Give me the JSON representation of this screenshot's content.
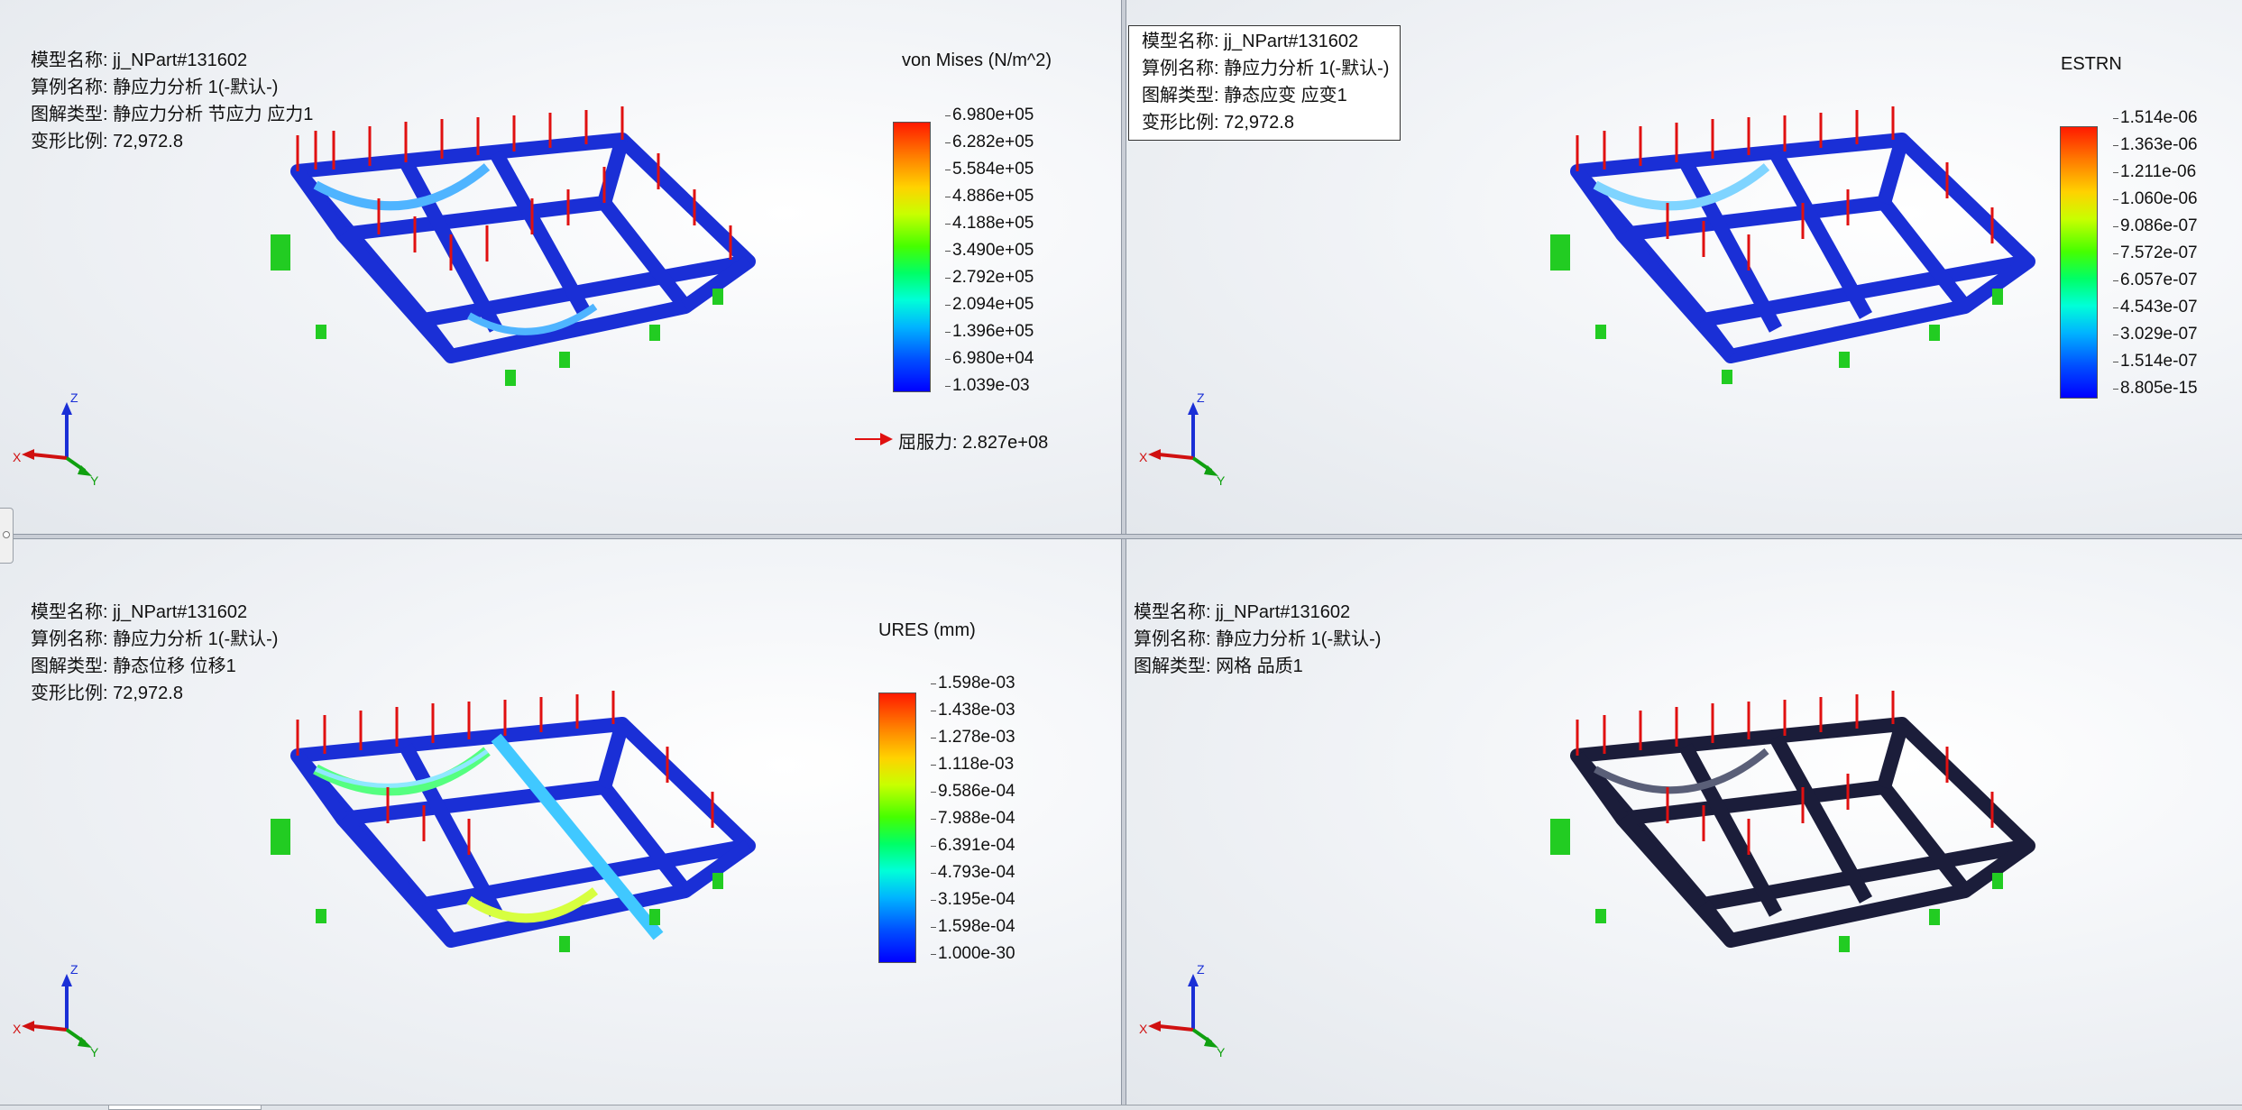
{
  "viewports": {
    "top_left": {
      "info": {
        "line1": "模型名称: jj_NPart#131602",
        "line2": "算例名称: 静应力分析 1(-默认-)",
        "line3": "图解类型: 静应力分析 节应力 应力1",
        "line4": "变形比例: 72,972.8"
      },
      "legend": {
        "title": "von Mises (N/m^2)",
        "ticks": [
          "6.980e+05",
          "6.282e+05",
          "5.584e+05",
          "4.886e+05",
          "4.188e+05",
          "3.490e+05",
          "2.792e+05",
          "2.094e+05",
          "1.396e+05",
          "6.980e+04",
          "1.039e-03"
        ],
        "yield_label": "屈服力: 2.827e+08"
      }
    },
    "top_right": {
      "info": {
        "line1": "模型名称: jj_NPart#131602",
        "line2": "算例名称: 静应力分析 1(-默认-)",
        "line3": "图解类型: 静态应变 应变1",
        "line4": "变形比例: 72,972.8"
      },
      "legend": {
        "title": "ESTRN",
        "ticks": [
          "1.514e-06",
          "1.363e-06",
          "1.211e-06",
          "1.060e-06",
          "9.086e-07",
          "7.572e-07",
          "6.057e-07",
          "4.543e-07",
          "3.029e-07",
          "1.514e-07",
          "8.805e-15"
        ]
      }
    },
    "bottom_left": {
      "info": {
        "line1": "模型名称: jj_NPart#131602",
        "line2": "算例名称: 静应力分析 1(-默认-)",
        "line3": "图解类型: 静态位移 位移1",
        "line4": "变形比例: 72,972.8"
      },
      "legend": {
        "title": "URES (mm)",
        "ticks": [
          "1.598e-03",
          "1.438e-03",
          "1.278e-03",
          "1.118e-03",
          "9.586e-04",
          "7.988e-04",
          "6.391e-04",
          "4.793e-04",
          "3.195e-04",
          "1.598e-04",
          "1.000e-30"
        ]
      }
    },
    "bottom_right": {
      "info": {
        "line1": "模型名称: jj_NPart#131602",
        "line2": "算例名称: 静应力分析 1(-默认-)",
        "line3": "图解类型: 网格 品质1"
      }
    }
  },
  "triad": {
    "x": "X",
    "y": "Y",
    "z": "Z"
  },
  "colors": {
    "frame_blue": "#1a2fd6",
    "mesh_dark": "#1b1d3a",
    "load_arrow": "#e01010",
    "fixture": "#22cc22",
    "yield_arrow": "#e01010"
  }
}
